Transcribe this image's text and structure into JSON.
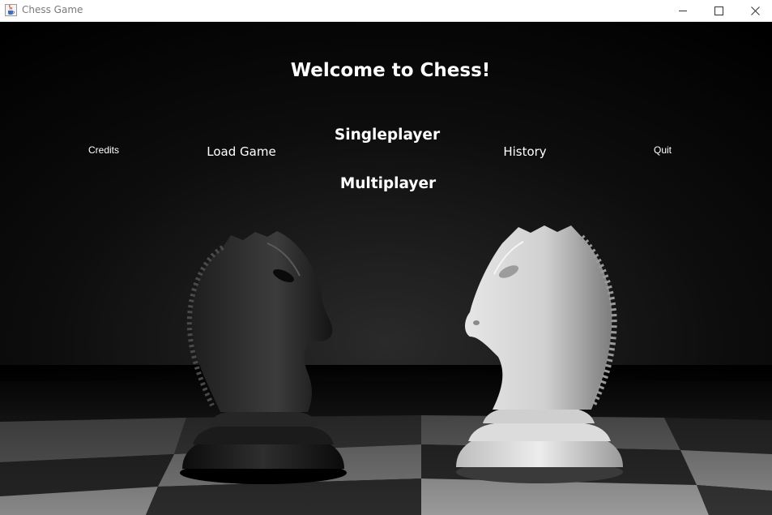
{
  "window": {
    "title": "Chess Game",
    "icon": "java-cup-icon",
    "controls": [
      "minimize-icon",
      "maximize-icon",
      "close-icon"
    ]
  },
  "menu": {
    "heading": "Welcome to Chess!",
    "singleplayer": "Singleplayer",
    "multiplayer": "Multiplayer",
    "credits": "Credits",
    "load_game": "Load Game",
    "history": "History",
    "quit": "Quit"
  },
  "background": {
    "image": "black-knight-and-white-knight-on-chessboard",
    "colors": {
      "base": "#000000",
      "text": "#ffffff"
    }
  }
}
